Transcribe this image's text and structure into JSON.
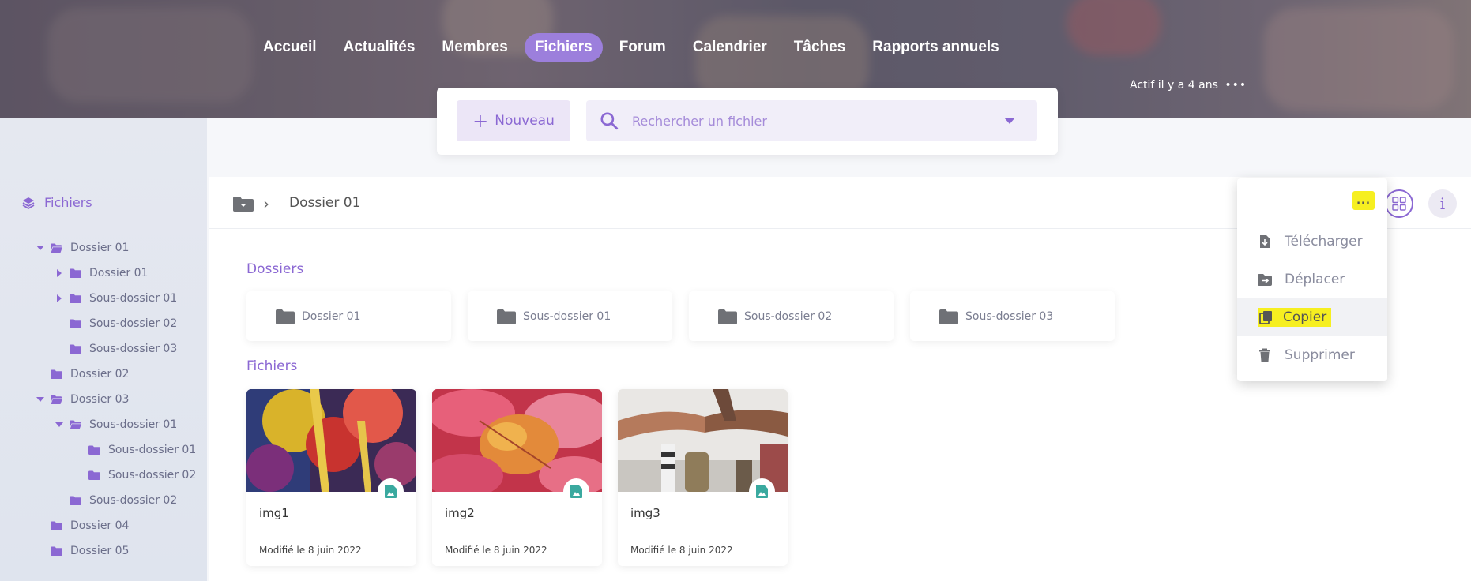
{
  "nav": {
    "items": [
      "Accueil",
      "Actualités",
      "Membres",
      "Fichiers",
      "Forum",
      "Calendrier",
      "Tâches",
      "Rapports annuels"
    ],
    "active": "Fichiers"
  },
  "activity": {
    "text": "Actif il y a 4 ans",
    "more": "•••"
  },
  "toolbar": {
    "new_label": "Nouveau",
    "search_placeholder": "Rechercher un fichier"
  },
  "sidebar": {
    "root": "Fichiers",
    "tree": [
      {
        "label": "Dossier 01",
        "level": 0,
        "state": "open"
      },
      {
        "label": "Dossier 01",
        "level": 1,
        "state": "closed"
      },
      {
        "label": "Sous-dossier 01",
        "level": 1,
        "state": "closed"
      },
      {
        "label": "Sous-dossier 02",
        "level": 1,
        "state": "leaf"
      },
      {
        "label": "Sous-dossier 03",
        "level": 1,
        "state": "leaf"
      },
      {
        "label": "Dossier 02",
        "level": 0,
        "state": "leaf"
      },
      {
        "label": "Dossier 03",
        "level": 0,
        "state": "open"
      },
      {
        "label": "Sous-dossier 01",
        "level": 1,
        "state": "open"
      },
      {
        "label": "Sous-dossier 01",
        "level": 2,
        "state": "leaf"
      },
      {
        "label": "Sous-dossier 02",
        "level": 2,
        "state": "leaf"
      },
      {
        "label": "Sous-dossier 02",
        "level": 1,
        "state": "leaf"
      },
      {
        "label": "Dossier 04",
        "level": 0,
        "state": "leaf"
      },
      {
        "label": "Dossier 05",
        "level": 0,
        "state": "leaf"
      }
    ]
  },
  "breadcrumb": {
    "current": "Dossier 01"
  },
  "sections": {
    "folders": "Dossiers",
    "files": "Fichiers"
  },
  "folders": [
    "Dossier 01",
    "Sous-dossier 01",
    "Sous-dossier 02",
    "Sous-dossier 03"
  ],
  "files": [
    {
      "name": "img1",
      "date": "Modifié le 8 juin 2022"
    },
    {
      "name": "img2",
      "date": "Modifié le 8 juin 2022"
    },
    {
      "name": "img3",
      "date": "Modifié le 8 juin 2022"
    }
  ],
  "menu": {
    "trigger": "...",
    "items": [
      "Télécharger",
      "Déplacer",
      "Copier",
      "Supprimer"
    ],
    "highlighted": "Copier"
  },
  "colors": {
    "accent": "#8b68d3",
    "highlight": "#f6ef20",
    "teal": "#3aa99f"
  }
}
